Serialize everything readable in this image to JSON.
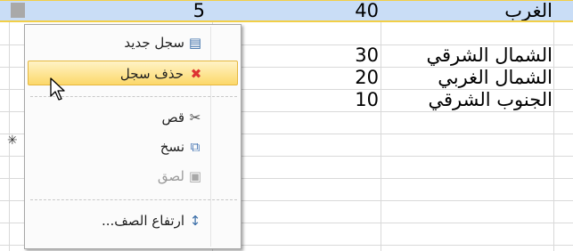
{
  "table": {
    "rows": [
      {
        "region": "الغرب",
        "value": "40",
        "id": "5",
        "selected": true
      },
      {
        "region": "الشمال الشرقي",
        "value": "30",
        "id": "",
        "selected": false
      },
      {
        "region": "الشمال الغربي",
        "value": "20",
        "id": "",
        "selected": false
      },
      {
        "region": "الجنوب الشرقي",
        "value": "10",
        "id": "",
        "selected": false
      }
    ],
    "new_row_marker": "✳"
  },
  "context_menu": {
    "items": [
      {
        "label": "سجل جديد",
        "icon": "new-record-icon",
        "glyph": "▤",
        "enabled": true
      },
      {
        "label": "حذف سجل",
        "icon": "delete-record-icon",
        "glyph": "✖",
        "enabled": true,
        "hover": true
      },
      {
        "label": "قص",
        "icon": "scissors-icon",
        "glyph": "✂",
        "enabled": true
      },
      {
        "label": "نسخ",
        "icon": "copy-icon",
        "glyph": "⧉",
        "enabled": true
      },
      {
        "label": "لصق",
        "icon": "paste-icon",
        "glyph": "📋",
        "enabled": false
      },
      {
        "label": "ارتفاع الصف...",
        "icon": "row-height-icon",
        "glyph": "↕",
        "enabled": true
      }
    ]
  },
  "colors": {
    "selection": "#c9ddf6",
    "accent": "#f2cf47",
    "hover": "#fcd86a"
  }
}
